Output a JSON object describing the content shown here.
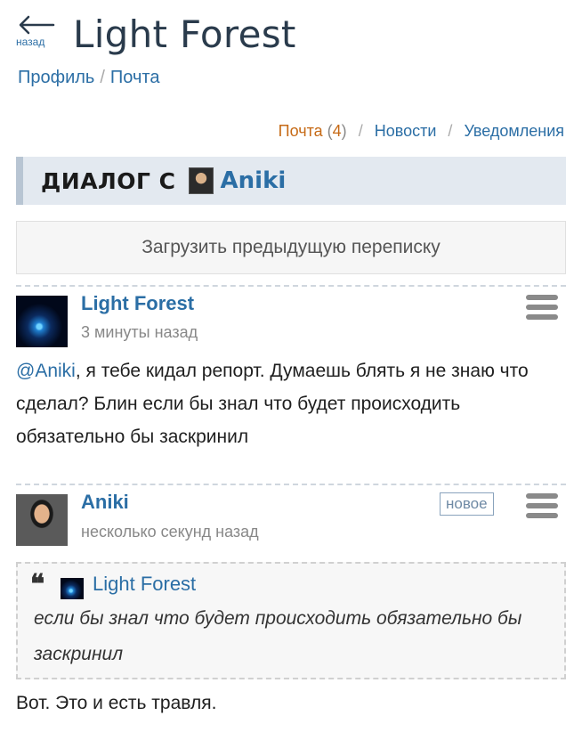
{
  "header": {
    "back_label": "назад",
    "title": "Light Forest"
  },
  "breadcrumb": [
    "Профиль",
    "Почта"
  ],
  "subnav": {
    "mail": "Почта",
    "mail_count": "4",
    "news": "Новости",
    "notifications": "Уведомления"
  },
  "dialog": {
    "heading": "ДИАЛОГ С",
    "partner": "Aniki"
  },
  "load_previous_label": "Загрузить предыдущую переписку",
  "messages": [
    {
      "author": "Light Forest",
      "time": "3 минуты назад",
      "mention": "@Aniki",
      "text": ", я тебе кидал репорт. Думаешь блять я не знаю что сделал? Блин если бы знал что будет происходить обязательно бы заскринил"
    },
    {
      "author": "Aniki",
      "time": "несколько секунд назад",
      "badge": "новое",
      "quote": {
        "author": "Light Forest",
        "text": "если бы знал что будет происходить обязательно бы заскринил"
      },
      "text": "Вот. Это и есть травля."
    }
  ]
}
